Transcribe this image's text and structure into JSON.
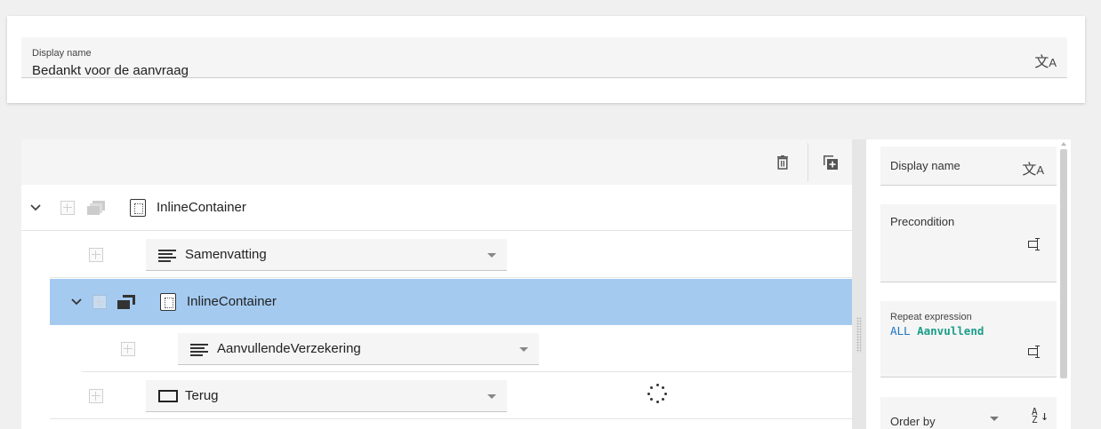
{
  "display_name": {
    "label": "Display name",
    "value": "Bedankt voor de aanvraag",
    "icon": "translate-icon"
  },
  "toolbar": {
    "delete_icon": "delete-icon",
    "copy_icon": "copy-icon"
  },
  "tree": {
    "rows": [
      {
        "type": "container",
        "label": "InlineContainer",
        "expanded": true,
        "selected": false
      },
      {
        "type": "element",
        "label": "Samenvatting"
      },
      {
        "type": "container",
        "label": "InlineContainer",
        "expanded": true,
        "selected": true
      },
      {
        "type": "element",
        "label": "AanvullendeVerzekering"
      },
      {
        "type": "element",
        "label": "Terug",
        "loading": true
      }
    ]
  },
  "properties": {
    "display_name_label": "Display name",
    "precondition_label": "Precondition",
    "repeat_expression_label": "Repeat expression",
    "repeat_expression": {
      "keyword": "ALL",
      "identifier": "Aanvullend"
    },
    "order_by_label": "Order by"
  },
  "colors": {
    "selected_row": "#a4caf0",
    "expr_keyword": "#1a75c2",
    "expr_identifier": "#1a9e8a"
  }
}
